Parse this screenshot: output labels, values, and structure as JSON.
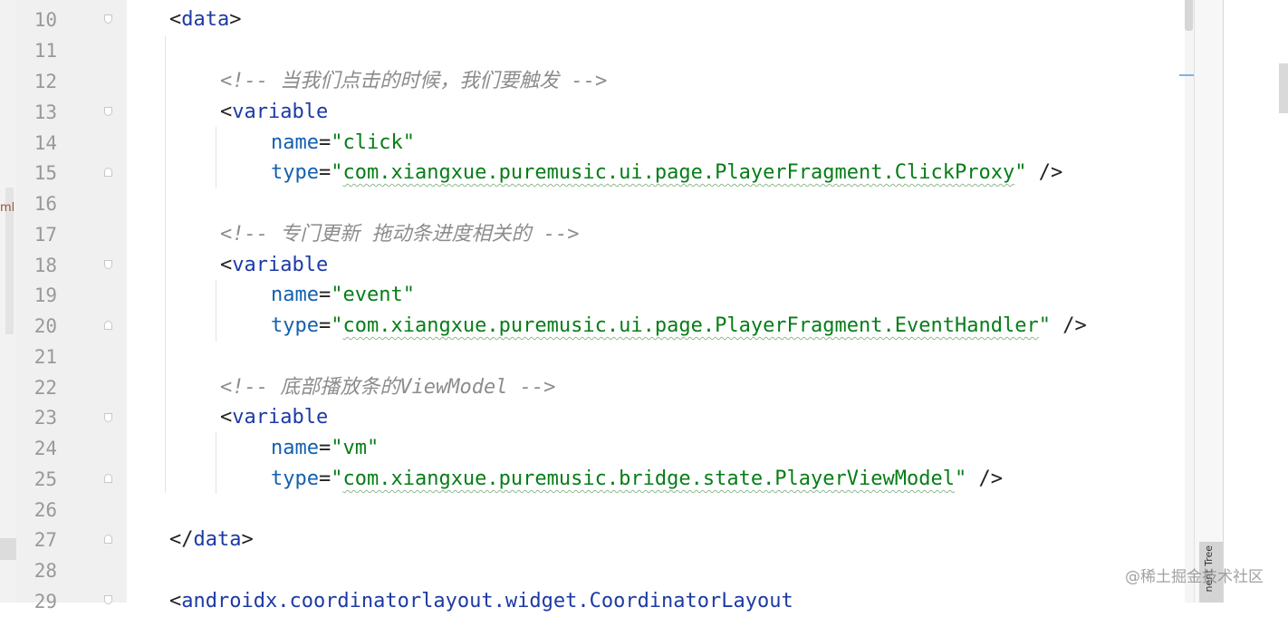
{
  "left_panel": {
    "label": "ml"
  },
  "line_numbers": [
    "10",
    "11",
    "12",
    "13",
    "14",
    "15",
    "16",
    "17",
    "18",
    "19",
    "20",
    "21",
    "22",
    "23",
    "24",
    "25",
    "26",
    "27",
    "28",
    "29"
  ],
  "code": {
    "l10": {
      "open": "<",
      "tag": "data",
      "close": ">"
    },
    "l12": {
      "comment": "<!-- 当我们点击的时候，我们要触发 -->"
    },
    "l13": {
      "open": "<",
      "tag": "variable"
    },
    "l14": {
      "attr": "name",
      "eq": "=",
      "value": "\"click\""
    },
    "l15": {
      "attr": "type",
      "eq": "=",
      "q1": "\"",
      "pkg": "com.xiangxue.puremusic.ui.page.PlayerFragment.ClickProxy",
      "q2": "\"",
      "end": " />"
    },
    "l17": {
      "comment": "<!-- 专门更新 拖动条进度相关的 -->"
    },
    "l18": {
      "open": "<",
      "tag": "variable"
    },
    "l19": {
      "attr": "name",
      "eq": "=",
      "value": "\"event\""
    },
    "l20": {
      "attr": "type",
      "eq": "=",
      "q1": "\"",
      "pkg": "com.xiangxue.puremusic.ui.page.PlayerFragment.EventHandler",
      "q2": "\"",
      "end": " />"
    },
    "l22": {
      "comment": "<!-- 底部播放条的ViewModel -->"
    },
    "l23": {
      "open": "<",
      "tag": "variable"
    },
    "l24": {
      "attr": "name",
      "eq": "=",
      "value": "\"vm\""
    },
    "l25": {
      "attr": "type",
      "eq": "=",
      "q1": "\"",
      "pkg": "com.xiangxue.puremusic.bridge.state.PlayerViewModel",
      "q2": "\"",
      "end": " />"
    },
    "l27": {
      "open": "</",
      "tag": "data",
      "close": ">"
    },
    "l29": {
      "open": "<",
      "tag": "androidx.coordinatorlayout.widget.CoordinatorLayout"
    }
  },
  "tool_tab": {
    "label": "nent Tree"
  },
  "watermark": "@稀土掘金技术社区"
}
